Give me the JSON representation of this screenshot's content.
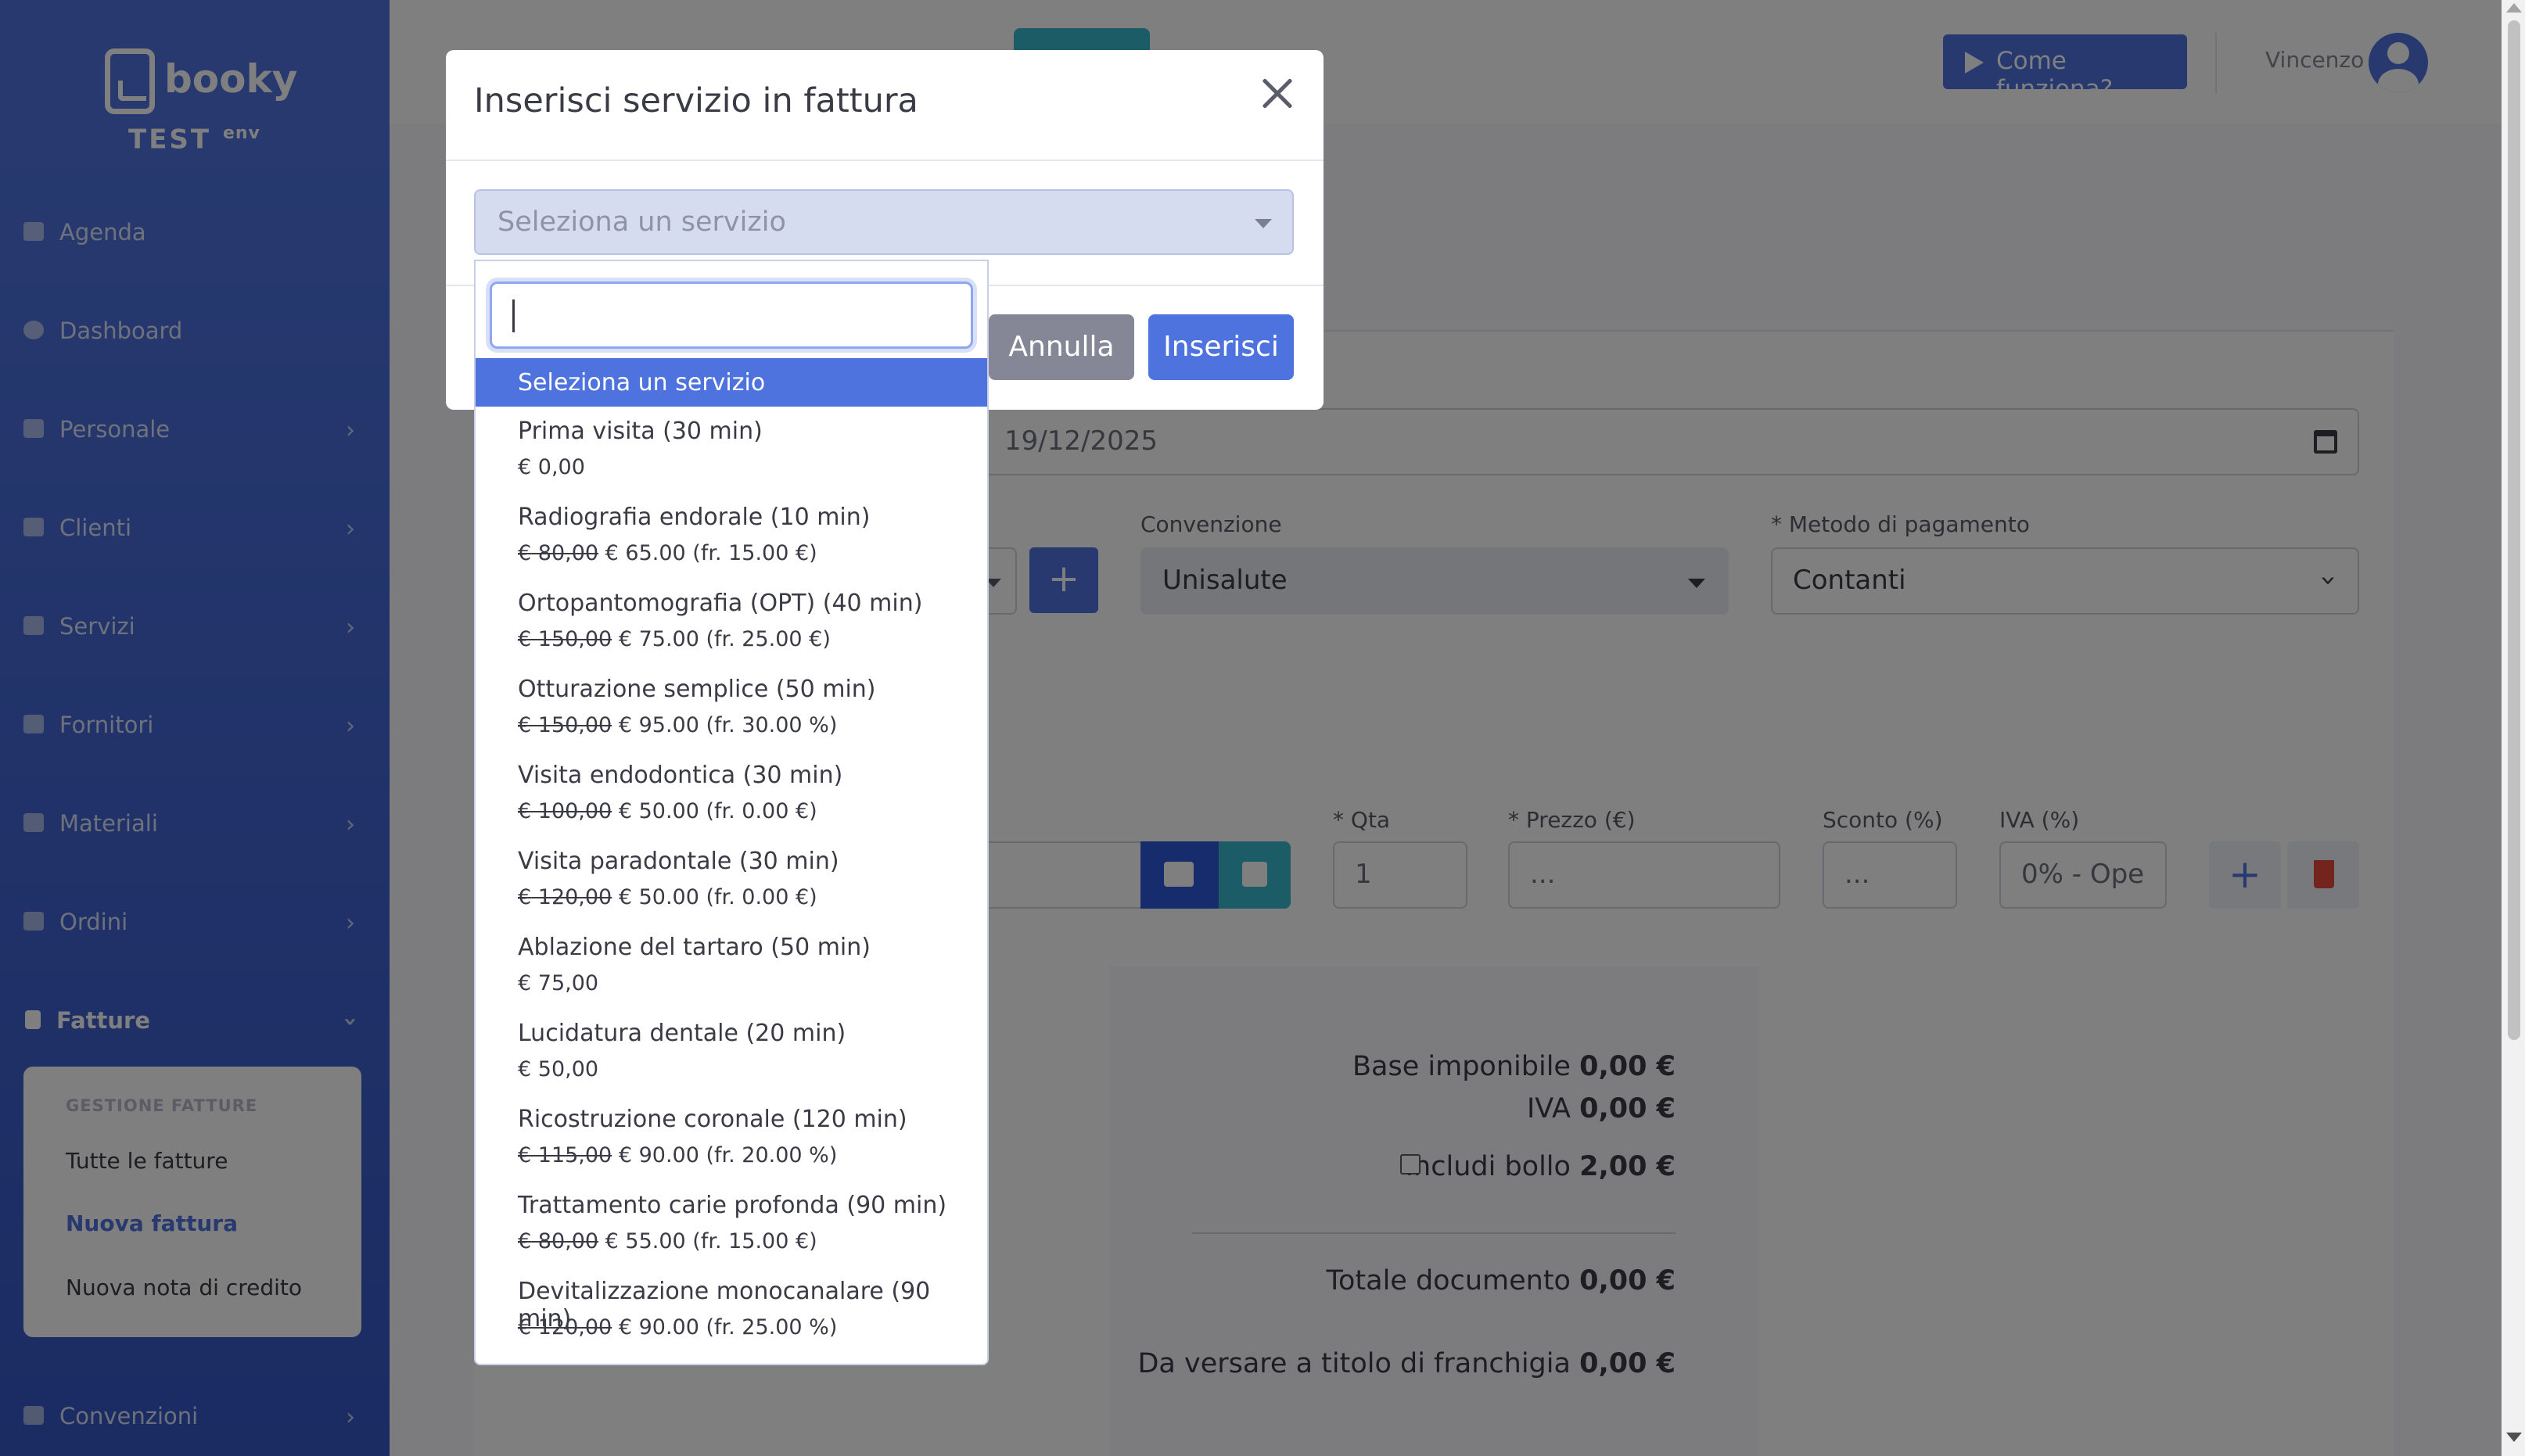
{
  "brand": {
    "name": "booky",
    "env": "TEST",
    "env_sup": "env"
  },
  "sidebar": {
    "items": [
      {
        "label": "Agenda",
        "icon": "calendar-icon"
      },
      {
        "label": "Dashboard",
        "icon": "dashboard-icon"
      },
      {
        "label": "Personale",
        "icon": "users-icon"
      },
      {
        "label": "Clienti",
        "icon": "users-icon"
      },
      {
        "label": "Servizi",
        "icon": "list-icon"
      },
      {
        "label": "Fornitori",
        "icon": "industry-icon"
      },
      {
        "label": "Materiali",
        "icon": "toolbox-icon"
      },
      {
        "label": "Ordini",
        "icon": "cart-icon"
      },
      {
        "label": "Fatture",
        "icon": "invoice-icon"
      },
      {
        "label": "Convenzioni",
        "icon": "handshake-icon"
      }
    ],
    "submenu": {
      "header": "GESTIONE FATTURE",
      "items": [
        "Tutte le fatture",
        "Nuova fattura",
        "Nuova nota di credito"
      ]
    }
  },
  "topbar": {
    "help_label": "Come funziona?",
    "user_name": "Vincenzo"
  },
  "form": {
    "date_value": "19/12/2025",
    "convenzione_label": "Convenzione",
    "convenzione_value": "Unisalute",
    "metodo_label": "* Metodo di pagamento",
    "metodo_value": "Contanti",
    "qta_label": "* Qta",
    "qta_value": "1",
    "prezzo_label": "* Prezzo (€)",
    "prezzo_value": "...",
    "sconto_label": "Sconto (%)",
    "sconto_value": "...",
    "iva_label": "IVA (%)",
    "iva_value": "0% - Ope"
  },
  "summary": {
    "base_label": "Base imponibile",
    "base_value": "0,00 €",
    "iva_label": "IVA",
    "iva_value": "0,00 €",
    "bollo_label": "Includi bollo",
    "bollo_value": "2,00 €",
    "totale_label": "Totale documento",
    "totale_value": "0,00 €",
    "franchigia_label": "Da versare a titolo di franchigia",
    "franchigia_value": "0,00 €"
  },
  "modal": {
    "title": "Inserisci servizio in fattura",
    "select_placeholder": "Seleziona un servizio",
    "cancel_label": "Annulla",
    "insert_label": "Inserisci"
  },
  "dropdown": {
    "selected": "Seleziona un servizio",
    "options": [
      {
        "name": "Prima visita (30 min)",
        "old": "",
        "price": "€ 0,00"
      },
      {
        "name": "Radiografia endorale (10 min)",
        "old": "€ 80,00",
        "price": "€ 65.00 (fr. 15.00 €)"
      },
      {
        "name": "Ortopantomografia (OPT) (40 min)",
        "old": "€ 150,00",
        "price": "€ 75.00 (fr. 25.00 €)"
      },
      {
        "name": "Otturazione semplice (50 min)",
        "old": "€ 150,00",
        "price": "€ 95.00 (fr. 30.00 %)"
      },
      {
        "name": "Visita endodontica (30 min)",
        "old": "€ 100,00",
        "price": "€ 50.00 (fr. 0.00 €)"
      },
      {
        "name": "Visita paradontale (30 min)",
        "old": "€ 120,00",
        "price": "€ 50.00 (fr. 0.00 €)"
      },
      {
        "name": "Ablazione del tartaro (50 min)",
        "old": "",
        "price": "€ 75,00"
      },
      {
        "name": "Lucidatura dentale (20 min)",
        "old": "",
        "price": "€ 50,00"
      },
      {
        "name": "Ricostruzione coronale (120 min)",
        "old": "€ 115,00",
        "price": "€ 90.00 (fr. 20.00 %)"
      },
      {
        "name": "Trattamento carie profonda (90 min)",
        "old": "€ 80,00",
        "price": "€ 55.00 (fr. 15.00 €)"
      },
      {
        "name": "Devitalizzazione monocanalare (90 min)",
        "old": "€ 120,00",
        "price": "€ 90.00 (fr. 25.00 %)"
      }
    ]
  }
}
